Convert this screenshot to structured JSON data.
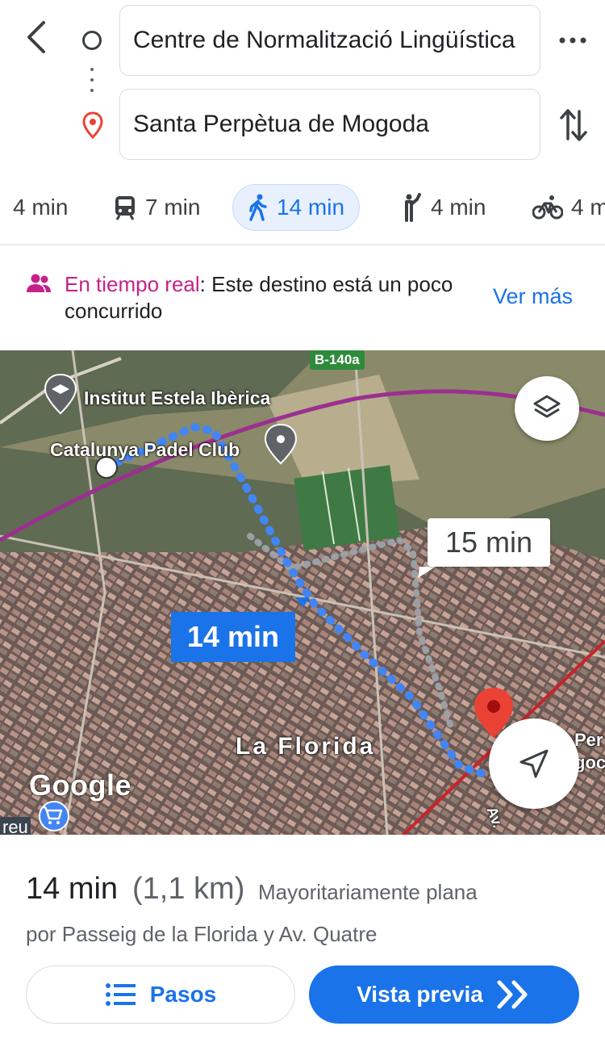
{
  "header": {
    "from": "Centre de Normalització Lingüística",
    "to": "Santa Perpètua de Mogoda"
  },
  "modes": [
    {
      "name": "car",
      "time": "4 min"
    },
    {
      "name": "transit",
      "time": "7 min"
    },
    {
      "name": "walk",
      "time": "14 min",
      "active": true
    },
    {
      "name": "ride",
      "time": "4 min"
    },
    {
      "name": "bike",
      "time": "4 m"
    }
  ],
  "realtime": {
    "highlight": "En tiempo real",
    "text": ": Este destino está un poco concurrido",
    "more": "Ver más"
  },
  "map": {
    "road_badge": "B-140a",
    "poi_school": "Institut Estela Ibèrica",
    "poi_padel": "Catalunya Padel Club",
    "area": "La Florida",
    "route_main_time": "14 min",
    "route_alt_time": "15 min",
    "partial_right_1": "Per",
    "partial_right_2": "goc",
    "partial_left": "reu",
    "partial_street": "Av.",
    "google": "Google"
  },
  "summary": {
    "time": "14 min",
    "distance": "(1,1 km)",
    "note": "Mayoritariamente plana",
    "via": "por Passeig de la Florida y Av. Quatre"
  },
  "buttons": {
    "steps": "Pasos",
    "preview": "Vista previa"
  },
  "colors": {
    "accent": "#1a73e8",
    "realtime": "#c5218a",
    "pin": "#ea4335"
  }
}
